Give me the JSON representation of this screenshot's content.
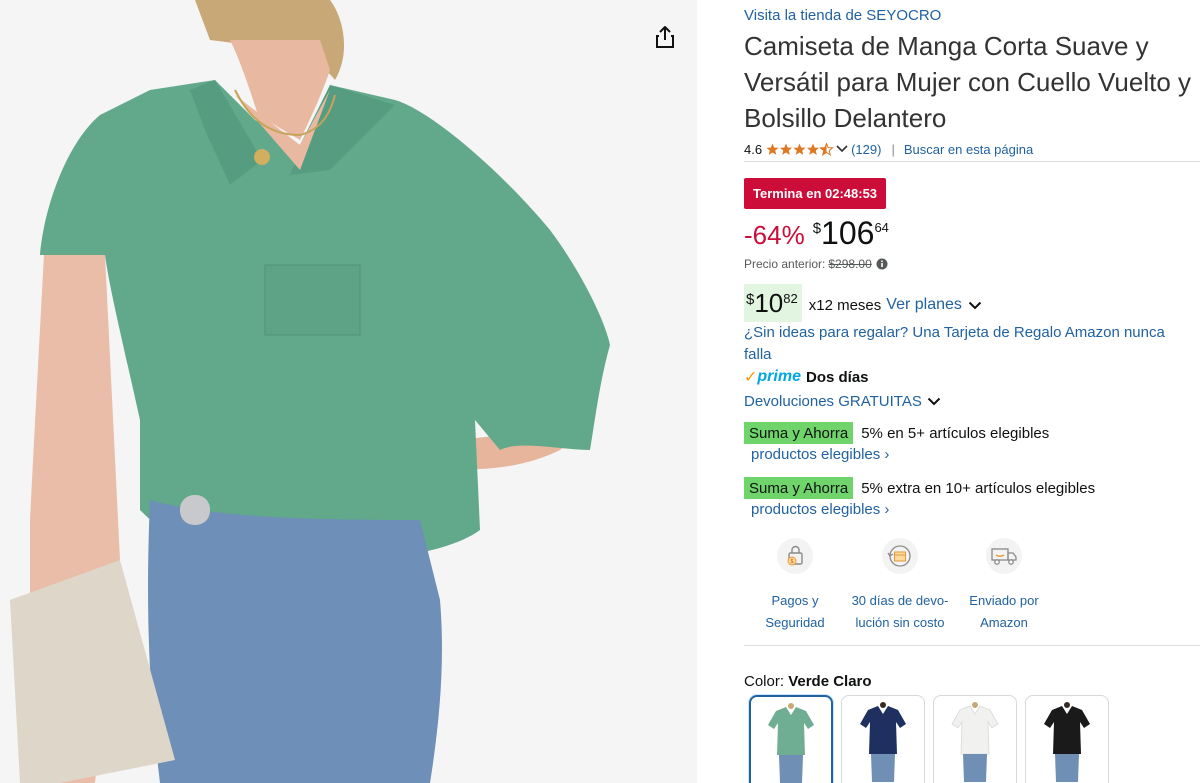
{
  "product": {
    "store_link": "Visita la tienda de SEYOCRO",
    "title": "Camiseta de Manga Corta Suave y Versátil para Mujer con Cuello Vuelto y Bolsillo Delantero",
    "rating": "4.6",
    "reviews": "(129)",
    "search_page": "Buscar en esta página",
    "stars_icon": "star-rating-icon"
  },
  "deal": {
    "badge": "Termina en 02:48:53",
    "discount": "-64%",
    "price_symbol": "$",
    "price_whole": "106",
    "price_fraction": "64",
    "previous_label": "Precio anterior:",
    "previous_price": "$298.00"
  },
  "installments": {
    "symbol": "$",
    "whole": "10",
    "fraction": "82",
    "text": "x12 meses",
    "link": "Ver planes"
  },
  "gift_link": "¿Sin ideas para regalar? Una Tarjeta de Regalo Amazon nunca falla",
  "prime": {
    "check": "✓",
    "word": "prime",
    "days": "Dos días"
  },
  "returns": "Devoluciones GRATUITAS",
  "promos": [
    {
      "tag": "Suma y Ahorra",
      "text": "5% en 5+ artículos elegibles",
      "link": "productos elegibles ›"
    },
    {
      "tag": "Suma y Ahorra",
      "text": "5% extra en 10+ artículos elegibles",
      "link": "productos elegibles ›"
    }
  ],
  "features": [
    {
      "icon": "secure-payment-icon",
      "line1": "Pagos y",
      "line2": "Seguridad"
    },
    {
      "icon": "return-box-icon",
      "line1": "30 días de devo-",
      "line2": "lución sin costo"
    },
    {
      "icon": "delivery-truck-icon",
      "line1": "Enviado por",
      "line2": "Amazon"
    }
  ],
  "color": {
    "label": "Color:",
    "value": "Verde Claro",
    "swatches": [
      {
        "name": "Verde Claro",
        "hex": "#6fae92"
      },
      {
        "name": "Azul Marino",
        "hex": "#1f2f5f"
      },
      {
        "name": "Blanco",
        "hex": "#f1f1ef"
      },
      {
        "name": "Negro",
        "hex": "#1a1a1a"
      }
    ]
  },
  "colors": {
    "link": "#2162a1",
    "deal_red": "#cc0c39",
    "promo_green": "#6fd56a",
    "prime_blue": "#00a8e1"
  }
}
